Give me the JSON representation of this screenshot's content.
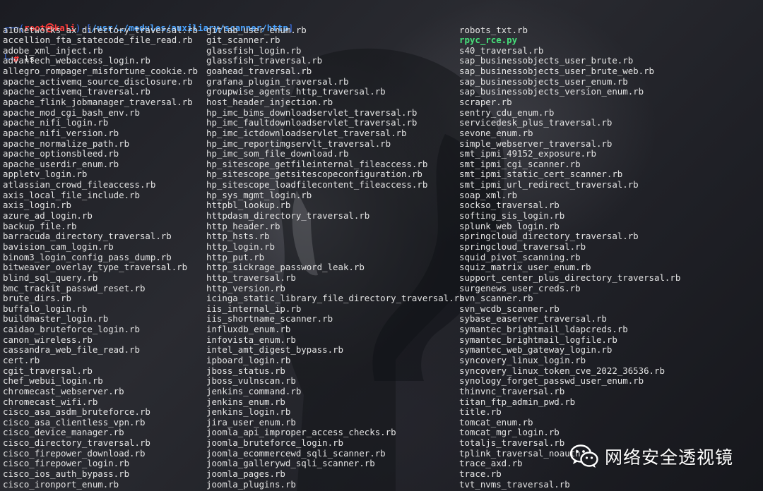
{
  "prompt": {
    "corner_top": "┌──(",
    "user_host": "root㉿kali",
    "mid": ")-[",
    "path": "/usr/…/modules/auxiliary/scanner/http",
    "close": "]",
    "corner_bottom": "└─",
    "hash": "#",
    "command": " ls"
  },
  "colors": {
    "prompt_bracket": "#3b78ff",
    "user": "#ff3b3b",
    "path": "#4aa3ff",
    "file_text": "#e4e4e4",
    "executable": "#46e07a"
  },
  "listing": {
    "col1": [
      "a10networks_ax_directory_traversal.rb",
      "accellion_fta_statecode_file_read.rb",
      "adobe_xml_inject.rb",
      "advantech_webaccess_login.rb",
      "allegro_rompager_misfortune_cookie.rb",
      "apache_activemq_source_disclosure.rb",
      "apache_activemq_traversal.rb",
      "apache_flink_jobmanager_traversal.rb",
      "apache_mod_cgi_bash_env.rb",
      "apache_nifi_login.rb",
      "apache_nifi_version.rb",
      "apache_normalize_path.rb",
      "apache_optionsbleed.rb",
      "apache_userdir_enum.rb",
      "appletv_login.rb",
      "atlassian_crowd_fileaccess.rb",
      "axis_local_file_include.rb",
      "axis_login.rb",
      "azure_ad_login.rb",
      "backup_file.rb",
      "barracuda_directory_traversal.rb",
      "bavision_cam_login.rb",
      "binom3_login_config_pass_dump.rb",
      "bitweaver_overlay_type_traversal.rb",
      "blind_sql_query.rb",
      "bmc_trackit_passwd_reset.rb",
      "brute_dirs.rb",
      "buffalo_login.rb",
      "buildmaster_login.rb",
      "caidao_bruteforce_login.rb",
      "canon_wireless.rb",
      "cassandra_web_file_read.rb",
      "cert.rb",
      "cgit_traversal.rb",
      "chef_webui_login.rb",
      "chromecast_webserver.rb",
      "chromecast_wifi.rb",
      "cisco_asa_asdm_bruteforce.rb",
      "cisco_asa_clientless_vpn.rb",
      "cisco_device_manager.rb",
      "cisco_directory_traversal.rb",
      "cisco_firepower_download.rb",
      "cisco_firepower_login.rb",
      "cisco_ios_auth_bypass.rb",
      "cisco_ironport_enum.rb"
    ],
    "col2": [
      "gitlab_user_enum.rb",
      "git_scanner.rb",
      "glassfish_login.rb",
      "glassfish_traversal.rb",
      "goahead_traversal.rb",
      "grafana_plugin_traversal.rb",
      "groupwise_agents_http_traversal.rb",
      "host_header_injection.rb",
      "hp_imc_bims_downloadservlet_traversal.rb",
      "hp_imc_faultdownloadservlet_traversal.rb",
      "hp_imc_ictdownloadservlet_traversal.rb",
      "hp_imc_reportimgservlt_traversal.rb",
      "hp_imc_som_file_download.rb",
      "hp_sitescope_getfileinternal_fileaccess.rb",
      "hp_sitescope_getsitescopeconfiguration.rb",
      "hp_sitescope_loadfilecontent_fileaccess.rb",
      "hp_sys_mgmt_login.rb",
      "httpbl_lookup.rb",
      "httpdasm_directory_traversal.rb",
      "http_header.rb",
      "http_hsts.rb",
      "http_login.rb",
      "http_put.rb",
      "http_sickrage_password_leak.rb",
      "http_traversal.rb",
      "http_version.rb",
      "icinga_static_library_file_directory_traversal.rb",
      "iis_internal_ip.rb",
      "iis_shortname_scanner.rb",
      "influxdb_enum.rb",
      "infovista_enum.rb",
      "intel_amt_digest_bypass.rb",
      "ipboard_login.rb",
      "jboss_status.rb",
      "jboss_vulnscan.rb",
      "jenkins_command.rb",
      "jenkins_enum.rb",
      "jenkins_login.rb",
      "jira_user_enum.rb",
      "joomla_api_improper_access_checks.rb",
      "joomla_bruteforce_login.rb",
      "joomla_ecommercewd_sqli_scanner.rb",
      "joomla_gallerywd_sqli_scanner.rb",
      "joomla_pages.rb",
      "joomla_plugins.rb"
    ],
    "col3": [
      "robots_txt.rb",
      "rpyc_rce.py",
      "s40_traversal.rb",
      "sap_businessobjects_user_brute.rb",
      "sap_businessobjects_user_brute_web.rb",
      "sap_businessobjects_user_enum.rb",
      "sap_businessobjects_version_enum.rb",
      "scraper.rb",
      "sentry_cdu_enum.rb",
      "servicedesk_plus_traversal.rb",
      "sevone_enum.rb",
      "simple_webserver_traversal.rb",
      "smt_ipmi_49152_exposure.rb",
      "smt_ipmi_cgi_scanner.rb",
      "smt_ipmi_static_cert_scanner.rb",
      "smt_ipmi_url_redirect_traversal.rb",
      "soap_xml.rb",
      "sockso_traversal.rb",
      "softing_sis_login.rb",
      "splunk_web_login.rb",
      "springcloud_directory_traversal.rb",
      "springcloud_traversal.rb",
      "squid_pivot_scanning.rb",
      "squiz_matrix_user_enum.rb",
      "support_center_plus_directory_traversal.rb",
      "surgenews_user_creds.rb",
      "svn_scanner.rb",
      "svn_wcdb_scanner.rb",
      "sybase_easerver_traversal.rb",
      "symantec_brightmail_ldapcreds.rb",
      "symantec_brightmail_logfile.rb",
      "symantec_web_gateway_login.rb",
      "syncovery_linux_login.rb",
      "syncovery_linux_token_cve_2022_36536.rb",
      "synology_forget_passwd_user_enum.rb",
      "thinvnc_traversal.rb",
      "titan_ftp_admin_pwd.rb",
      "title.rb",
      "tomcat_enum.rb",
      "tomcat_mgr_login.rb",
      "totaljs_traversal.rb",
      "tplink_traversal_noauth",
      "trace_axd.rb",
      "trace.rb",
      "tvt_nvms_traversal.rb"
    ],
    "executables": [
      "rpyc_rce.py"
    ]
  },
  "watermark": {
    "icon": "wechat-icon",
    "text": "网络安全透视镜"
  }
}
